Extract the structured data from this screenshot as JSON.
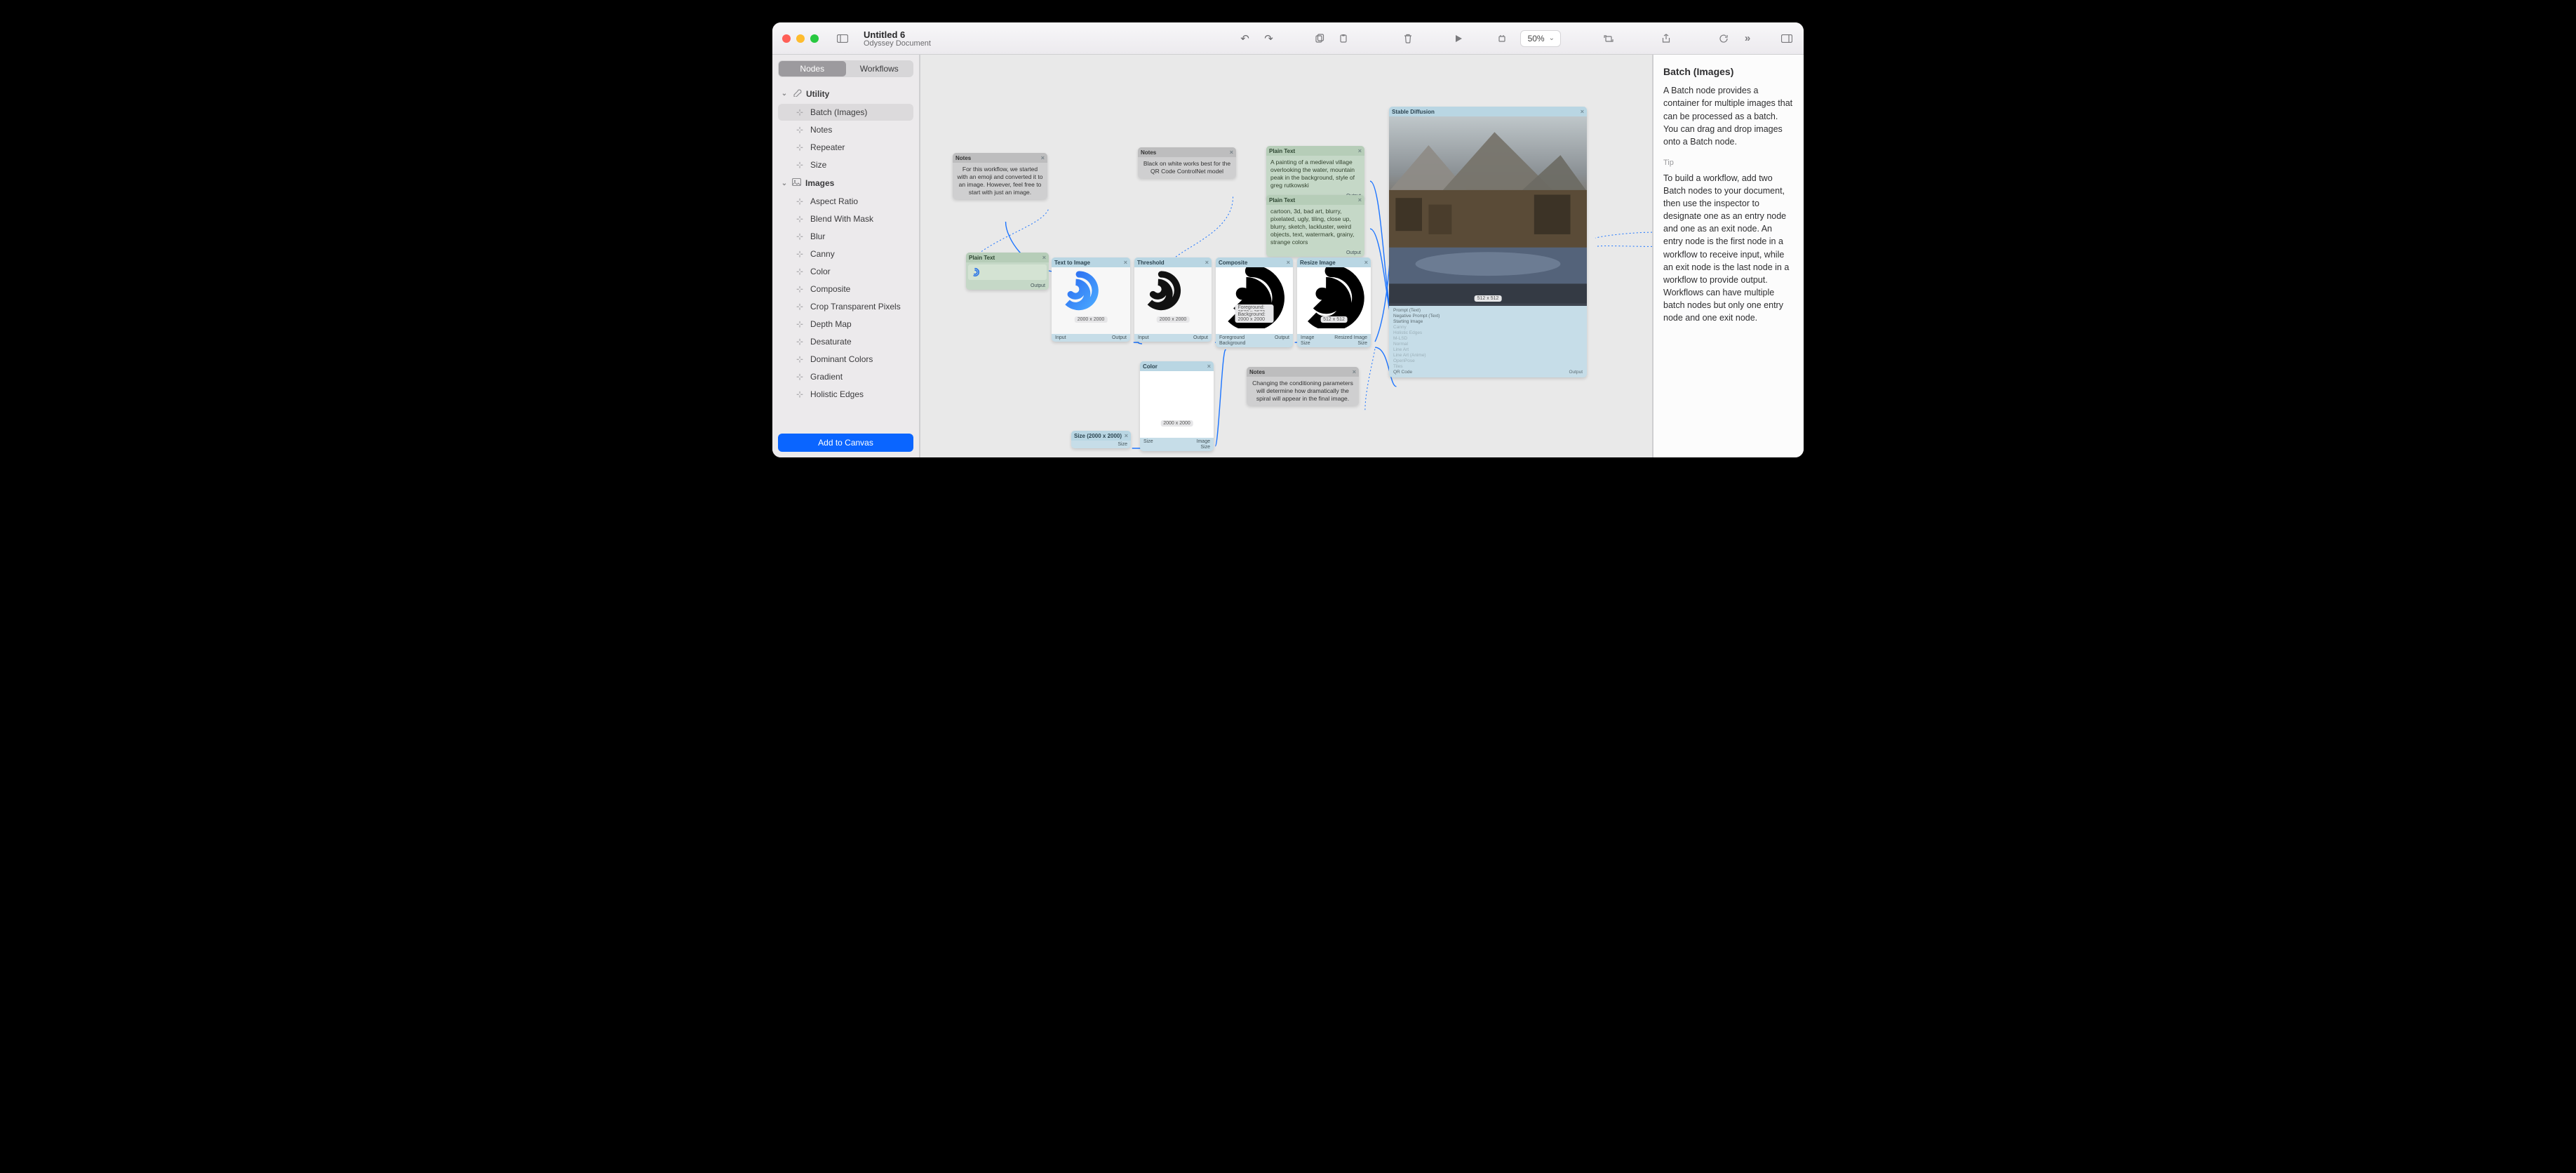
{
  "header": {
    "title": "Untitled 6",
    "subtitle": "Odyssey Document",
    "zoom": "50%"
  },
  "segmented": {
    "nodes": "Nodes",
    "workflows": "Workflows"
  },
  "groups": [
    {
      "name": "Utility",
      "items": [
        "Batch (Images)",
        "Notes",
        "Repeater",
        "Size"
      ],
      "selectedIndex": 0,
      "icon": "util"
    },
    {
      "name": "Images",
      "items": [
        "Aspect Ratio",
        "Blend With Mask",
        "Blur",
        "Canny",
        "Color",
        "Composite",
        "Crop Transparent Pixels",
        "Depth Map",
        "Desaturate",
        "Dominant Colors",
        "Gradient",
        "Holistic Edges"
      ],
      "selectedIndex": -1,
      "icon": "img"
    }
  ],
  "addBtn": "Add to Canvas",
  "inspector": {
    "title": "Batch (Images)",
    "desc": "A Batch node provides a container for multiple images that can be processed as a batch. You can drag and drop images onto a Batch node.",
    "tipLabel": "Tip",
    "tipBody": "To build a workflow, add two Batch nodes to your document, then use the inspector to designate one as an entry node and one as an exit node. An entry node is the first node in a workflow to receive input, while an exit node is the last node in a workflow to provide output. Workflows can have multiple batch nodes but only one entry node and one exit node."
  },
  "nodes": {
    "note1": {
      "title": "Notes",
      "text": "For this workflow, we started with an emoji and converted it to an image. However, feel free to start with just an image."
    },
    "note2": {
      "title": "Notes",
      "text": "Black on white works best for the QR Code ControlNet model"
    },
    "note3": {
      "title": "Notes",
      "text": "Changing the conditioning parameters will determine how dramatically the spiral will appear in the final image."
    },
    "prompt1": {
      "title": "Plain Text",
      "text": "A painting of a medieval village overlooking the water, mountain peak in the background, style of greg rutkowski",
      "out": "Output"
    },
    "prompt2": {
      "title": "Plain Text",
      "text": "cartoon, 3d, bad art, blurry, pixelated, ugly, tiling, close up, blurry, sketch, lackluster, weird objects, text, watermark, grainy, strange colors",
      "out": "Output"
    },
    "plainText": {
      "title": "Plain Text",
      "out": "Output"
    },
    "t2i": {
      "title": "Text to Image",
      "tag": "2000 x 2000",
      "in": "Input",
      "out": "Output"
    },
    "thr": {
      "title": "Threshold",
      "tag": "2000 x 2000",
      "in": "Input",
      "out": "Output"
    },
    "comp": {
      "title": "Composite",
      "tag1": "Foreground: 3672 x 3672",
      "tag2": "Background: 2000 x 2000",
      "p1": "Foreground",
      "p2": "Background",
      "out": "Output"
    },
    "resize": {
      "title": "Resize Image",
      "tag": "512 x 512",
      "p1": "Image",
      "p2": "Size",
      "out": "Resized Image",
      "out2": "Size"
    },
    "color": {
      "title": "Color",
      "tag": "2000 x 2000",
      "p1": "Size",
      "out1": "Image",
      "out2": "Size"
    },
    "size": {
      "title": "Size (2000 x 2000)",
      "out": "Size"
    },
    "sd": {
      "title": "Stable Diffusion",
      "tag": "512 x 512",
      "ports": [
        "Prompt (Text)",
        "Negative Prompt (Text)",
        "Starting Image",
        "Canny",
        "Holistic Edges",
        "M-LSD",
        "Normal",
        "Line Art",
        "Line Art (Anime)",
        "OpenPose",
        "Tiles",
        "QR Code"
      ],
      "out": "Output"
    }
  }
}
